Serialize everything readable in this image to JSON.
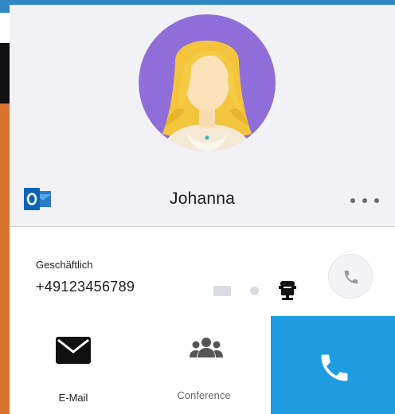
{
  "contact": {
    "name": "Johanna",
    "source_icon": "outlook-icon",
    "avatar_bg_color": "#8f6ed9"
  },
  "phone": {
    "type_label": "Geschäftlich",
    "number": "+49123456789"
  },
  "actions": {
    "email_label": "E-Mail",
    "conference_label": "Conference",
    "call_color": "#1d9ce0"
  },
  "icons": [
    "outlook-icon",
    "more-icon",
    "phone-icon",
    "desk-phone-icon",
    "email-icon",
    "conference-icon"
  ]
}
